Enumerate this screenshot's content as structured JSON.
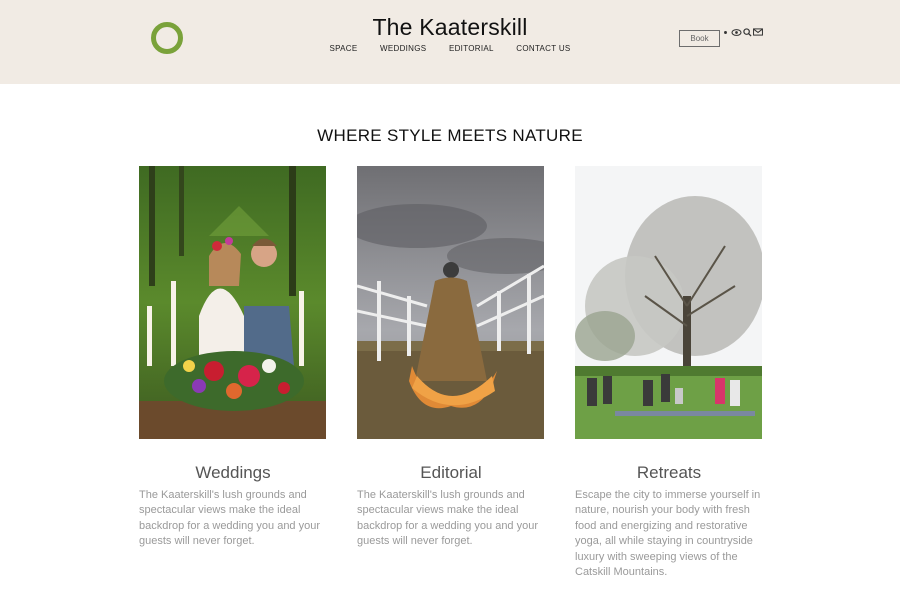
{
  "header": {
    "title": "The Kaaterskill",
    "nav": [
      "SPACE",
      "WEDDINGS",
      "EDITORIAL",
      "CONTACT US"
    ],
    "book_label": "Book",
    "icons": [
      "instagram-icon",
      "eye-icon",
      "search-icon",
      "mail-icon"
    ],
    "accent_color": "#7aa23a",
    "background_color": "#f1ebe4"
  },
  "tagline": "WHERE STYLE MEETS NATURE",
  "cards": [
    {
      "title": "Weddings",
      "text": "The Kaaterskill's lush grounds and spectacular views make the ideal backdrop for a wedding you and your guests will never forget."
    },
    {
      "title": "Editorial",
      "text": "The Kaaterskill's lush grounds and spectacular views make the ideal backdrop for a wedding you and your guests will never forget."
    },
    {
      "title": "Retreats",
      "text": "Escape the city to immerse yourself in nature, nourish your body with fresh food and energizing and restorative yoga, all while staying in countryside luxury with sweeping views of the Catskill Mountains."
    }
  ]
}
